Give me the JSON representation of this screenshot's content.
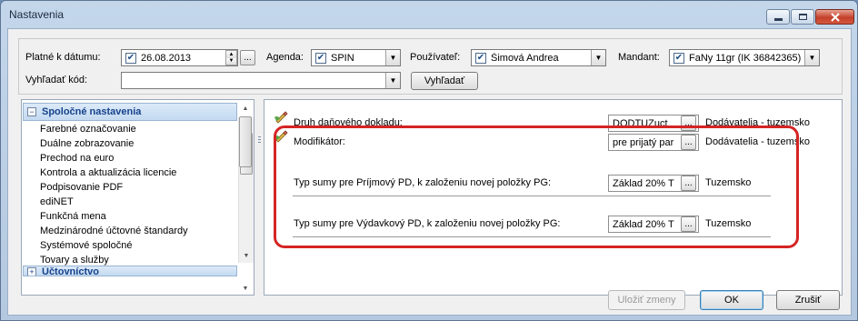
{
  "window": {
    "title": "Nastavenia",
    "controls": {
      "minimize": "minimize-icon",
      "maximize": "maximize-icon",
      "close": "close-icon"
    }
  },
  "filters": {
    "date_label": "Platné k dátumu:",
    "date_value": "26.08.2013",
    "agenda_label": "Agenda:",
    "agenda_value": "SPIN",
    "user_label": "Používateľ:",
    "user_value": "Šimová Andrea",
    "mandant_label": "Mandant:",
    "mandant_value": "FaNy 11gr (IK 36842365)",
    "search_label": "Vyhľadať kód:",
    "search_value": "",
    "search_button": "Vyhľadať",
    "ellipsis": "..."
  },
  "left_panel": {
    "group1_title": "Spoločné nastavenia",
    "group1_toggle": "−",
    "items": [
      "Farebné označovanie",
      "Duálne zobrazovanie",
      "Prechod na euro",
      "Kontrola a aktualizácia licencie",
      "Podpisovanie PDF",
      "ediNET",
      "Funkčná mena",
      "Medzinárodné účtovné štandardy",
      "Systémové spoločné",
      "Tovary a služby"
    ],
    "group2_title": "Účtovníctvo",
    "group2_toggle": "+"
  },
  "right_panel": {
    "rows": [
      {
        "label": "Druh daňového dokladu:",
        "value": "DODTUZuct",
        "description": "Dodávatelia - tuzemsko"
      },
      {
        "label": "Modifikátor:",
        "value": "pre prijatý par",
        "description": "Dodávatelia - tuzemsko"
      },
      {
        "label": "Typ sumy pre Príjmový PD, k  založeniu novej položky PG:",
        "value": "Základ 20% T",
        "description": "Tuzemsko"
      },
      {
        "label": "Typ sumy pre Výdavkový PD, k  založeniu novej položky PG:",
        "value": "Základ 20% T",
        "description": "Tuzemsko"
      }
    ]
  },
  "footer": {
    "save_button": "Uložiť zmeny",
    "ok_button": "OK",
    "cancel_button": "Zrušiť"
  },
  "colors": {
    "highlight": "#d52424",
    "group_header_text": "#15428b"
  }
}
